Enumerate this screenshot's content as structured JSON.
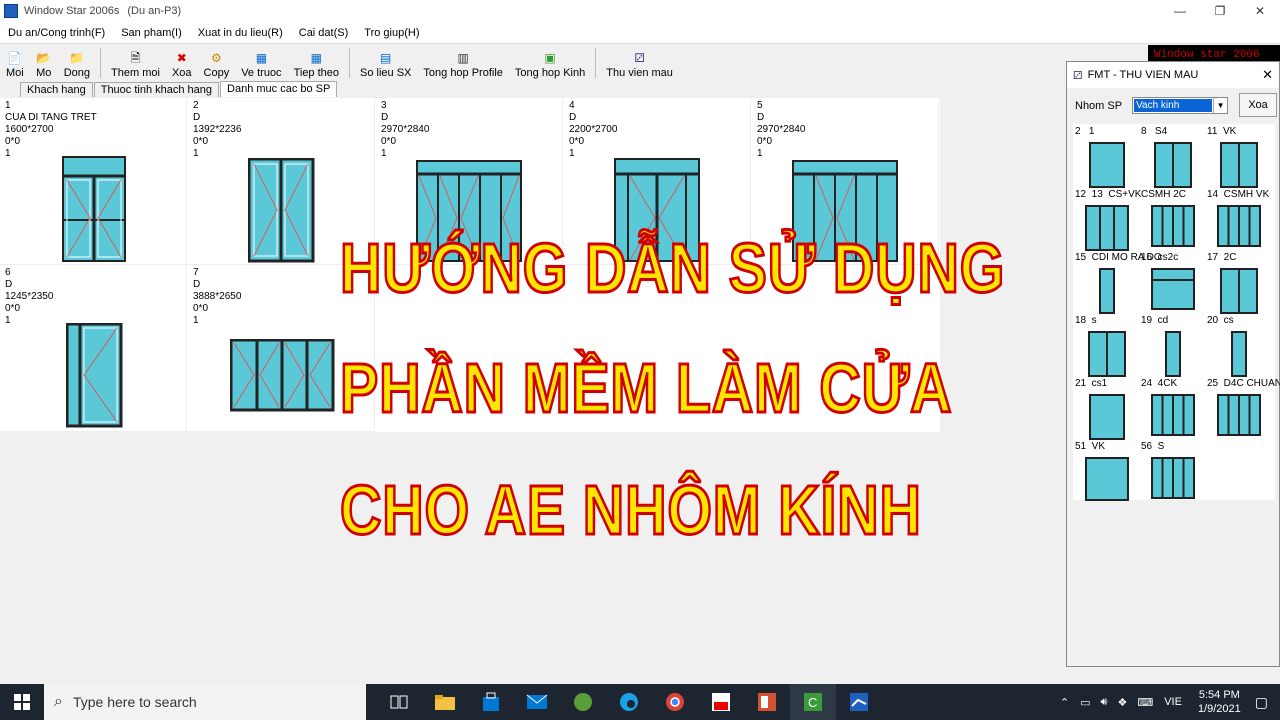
{
  "window": {
    "title": "Window Star 2006s",
    "project": "(Du an-P3)",
    "brand": "Window star 2006"
  },
  "menu": [
    "Du an/Cong trinh(F)",
    "San pham(I)",
    "Xuat in du lieu(R)",
    "Cai dat(S)",
    "Tro giup(H)"
  ],
  "toolbar": [
    "Moi",
    "Mo",
    "Dong",
    "Them moi",
    "Xoa",
    "Copy",
    "Ve truoc",
    "Tiep theo",
    "So lieu SX",
    "Tong hop Profile",
    "Tong hop Kinh",
    "Thu vien mau"
  ],
  "tabs": [
    "Khach hang",
    "Thuoc tinh khach hang",
    "Danh muc cac bo SP"
  ],
  "products": [
    {
      "id": "1",
      "name": "CUA DI TANG TRET",
      "size": "1600*2700",
      "offset": "0*0",
      "qty": "1"
    },
    {
      "id": "2",
      "name": "D",
      "size": "1392*2236",
      "offset": "0*0",
      "qty": "1"
    },
    {
      "id": "3",
      "name": "D",
      "size": "2970*2840",
      "offset": "0*0",
      "qty": "1"
    },
    {
      "id": "4",
      "name": "D",
      "size": "2200*2700",
      "offset": "0*0",
      "qty": "1"
    },
    {
      "id": "5",
      "name": "D",
      "size": "2970*2840",
      "offset": "0*0",
      "qty": "1"
    },
    {
      "id": "6",
      "name": "D",
      "size": "1245*2350",
      "offset": "0*0",
      "qty": "1"
    },
    {
      "id": "7",
      "name": "D",
      "size": "3888*2650",
      "offset": "0*0",
      "qty": "1"
    }
  ],
  "dialog": {
    "title": "FMT - THU VIEN MAU",
    "group_label": "Nhom SP",
    "group_value": "Vach kinh",
    "delete_label": "Xoa",
    "items": [
      "2   1",
      "8   S4",
      "11  VK",
      "12  13  CS+VK",
      "CSMH 2C",
      "14  CSMH VK",
      "15  CDI MO RA DO",
      "16  cs2c",
      "17  2C",
      "18  s",
      "19  cd",
      "20  cs",
      "21  cs1",
      "24  4CK",
      "25  D4C CHUAN",
      "51  VK",
      "56  S"
    ]
  },
  "overlay": [
    "HƯỚNG DẪN SỬ DỤNG",
    "PHẦN MỀM LÀM CỬA",
    "CHO AE NHÔM KÍNH"
  ],
  "taskbar": {
    "search": "Type here to search",
    "lang": "VIE",
    "time": "5:54 PM",
    "date": "1/9/2021"
  }
}
